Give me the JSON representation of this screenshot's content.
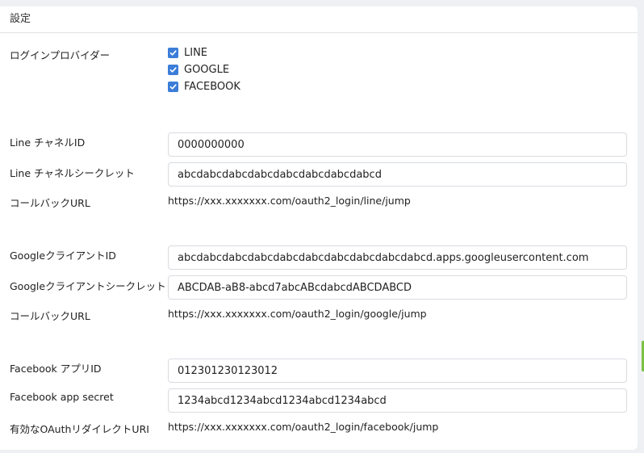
{
  "header": {
    "title": "設定"
  },
  "login_providers": {
    "label": "ログインプロバイダー",
    "options": [
      {
        "label": "LINE",
        "checked": true
      },
      {
        "label": "GOOGLE",
        "checked": true
      },
      {
        "label": "FACEBOOK",
        "checked": true
      }
    ]
  },
  "line": {
    "channel_id_label": "Line チャネルID",
    "channel_id_value": "0000000000",
    "channel_secret_label": "Line チャネルシークレット",
    "channel_secret_value": "abcdabcdabcdabcdabcdabcdabcdabcd",
    "callback_label": "コールバックURL",
    "callback_value": "https://xxx.xxxxxxx.com/oauth2_login/line/jump"
  },
  "google": {
    "client_id_label": "GoogleクライアントID",
    "client_id_value": "abcdabcdabcdabcdabcdabcdabcdabcdabcdabcd.apps.googleusercontent.com",
    "client_secret_label": "Googleクライアントシークレット",
    "client_secret_value": "ABCDAB-aB8-abcd7abcABcdabcdABCDABCD",
    "callback_label": "コールバックURL",
    "callback_value": "https://xxx.xxxxxxx.com/oauth2_login/google/jump"
  },
  "facebook": {
    "app_id_label": "Facebook アプリID",
    "app_id_value": "012301230123012",
    "app_secret_label": "Facebook app secret",
    "app_secret_value": "1234abcd1234abcd1234abcd1234abcd",
    "redirect_label": "有効なOAuthリダイレクトURI",
    "redirect_value": "https://xxx.xxxxxxx.com/oauth2_login/facebook/jump"
  },
  "colors": {
    "accent": "#3b7dd8",
    "border": "#d8dbe0",
    "background": "#eef0f3",
    "side_tab": "#7bc043"
  }
}
